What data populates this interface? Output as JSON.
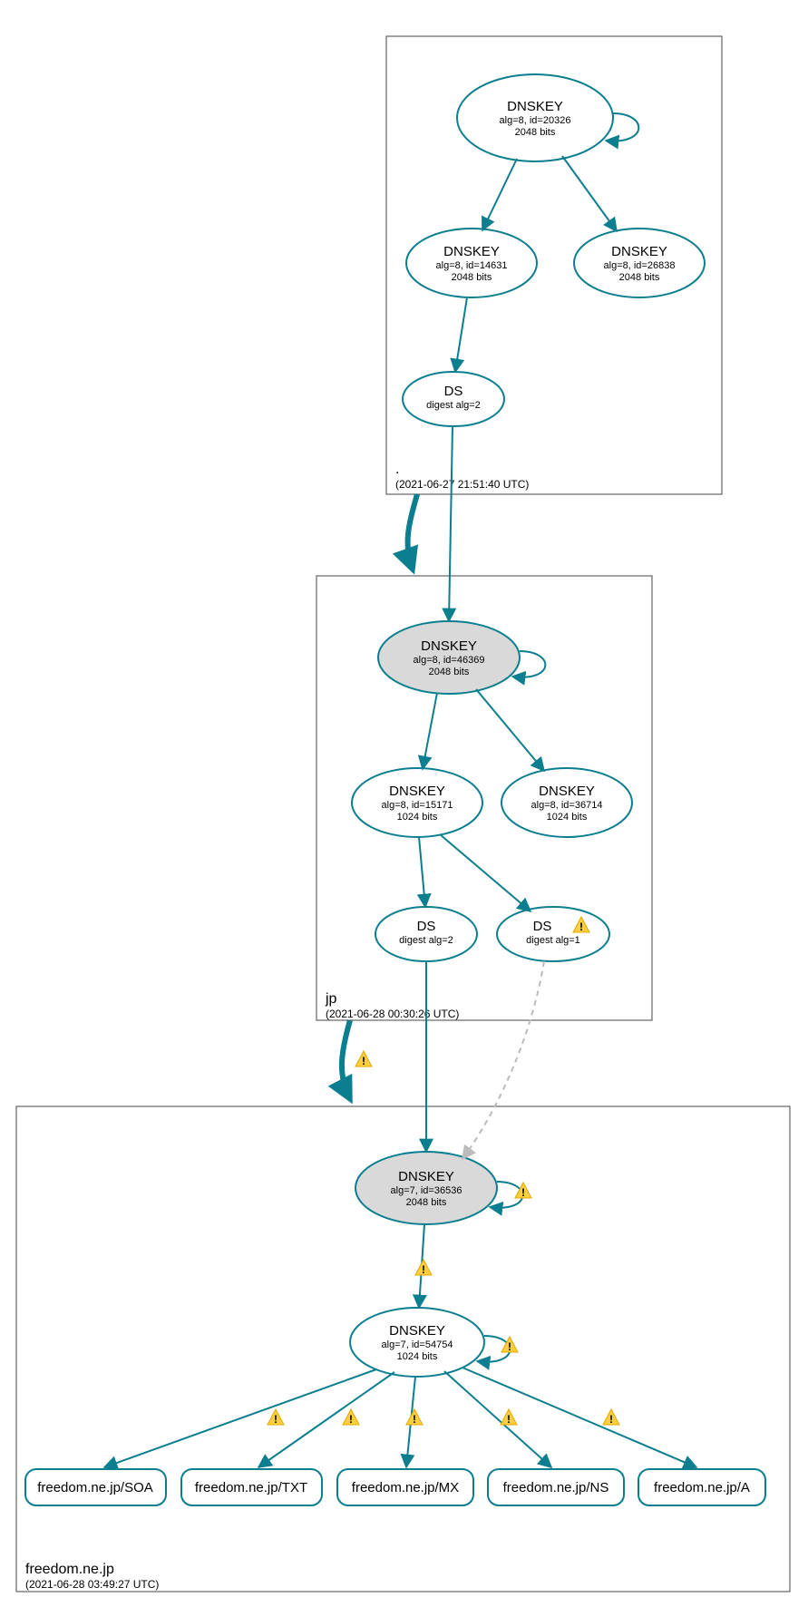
{
  "colors": {
    "edge": "#0b7e8f",
    "ksk_fill": "#d9d9d9",
    "warn": "#ffcf3f"
  },
  "zones": {
    "root": {
      "label": ".",
      "timestamp": "(2021-06-27 21:51:40 UTC)"
    },
    "jp": {
      "label": "jp",
      "timestamp": "(2021-06-28 00:30:26 UTC)"
    },
    "leaf": {
      "label": "freedom.ne.jp",
      "timestamp": "(2021-06-28 03:49:27 UTC)"
    }
  },
  "nodes": {
    "root_ksk": {
      "title": "DNSKEY",
      "l2": "alg=8, id=20326",
      "l3": "2048 bits"
    },
    "root_zsk": {
      "title": "DNSKEY",
      "l2": "alg=8, id=14631",
      "l3": "2048 bits"
    },
    "root_k2": {
      "title": "DNSKEY",
      "l2": "alg=8, id=26838",
      "l3": "2048 bits"
    },
    "root_ds": {
      "title": "DS",
      "l2": "digest alg=2"
    },
    "jp_ksk": {
      "title": "DNSKEY",
      "l2": "alg=8, id=46369",
      "l3": "2048 bits"
    },
    "jp_zsk": {
      "title": "DNSKEY",
      "l2": "alg=8, id=15171",
      "l3": "1024 bits"
    },
    "jp_k2": {
      "title": "DNSKEY",
      "l2": "alg=8, id=36714",
      "l3": "1024 bits"
    },
    "jp_ds2": {
      "title": "DS",
      "l2": "digest alg=2"
    },
    "jp_ds1": {
      "title": "DS",
      "l2": "digest alg=1"
    },
    "leaf_ksk": {
      "title": "DNSKEY",
      "l2": "alg=7, id=36536",
      "l3": "2048 bits"
    },
    "leaf_zsk": {
      "title": "DNSKEY",
      "l2": "alg=7, id=54754",
      "l3": "1024 bits"
    }
  },
  "rrsets": {
    "soa": "freedom.ne.jp/SOA",
    "txt": "freedom.ne.jp/TXT",
    "mx": "freedom.ne.jp/MX",
    "ns": "freedom.ne.jp/NS",
    "a": "freedom.ne.jp/A"
  }
}
